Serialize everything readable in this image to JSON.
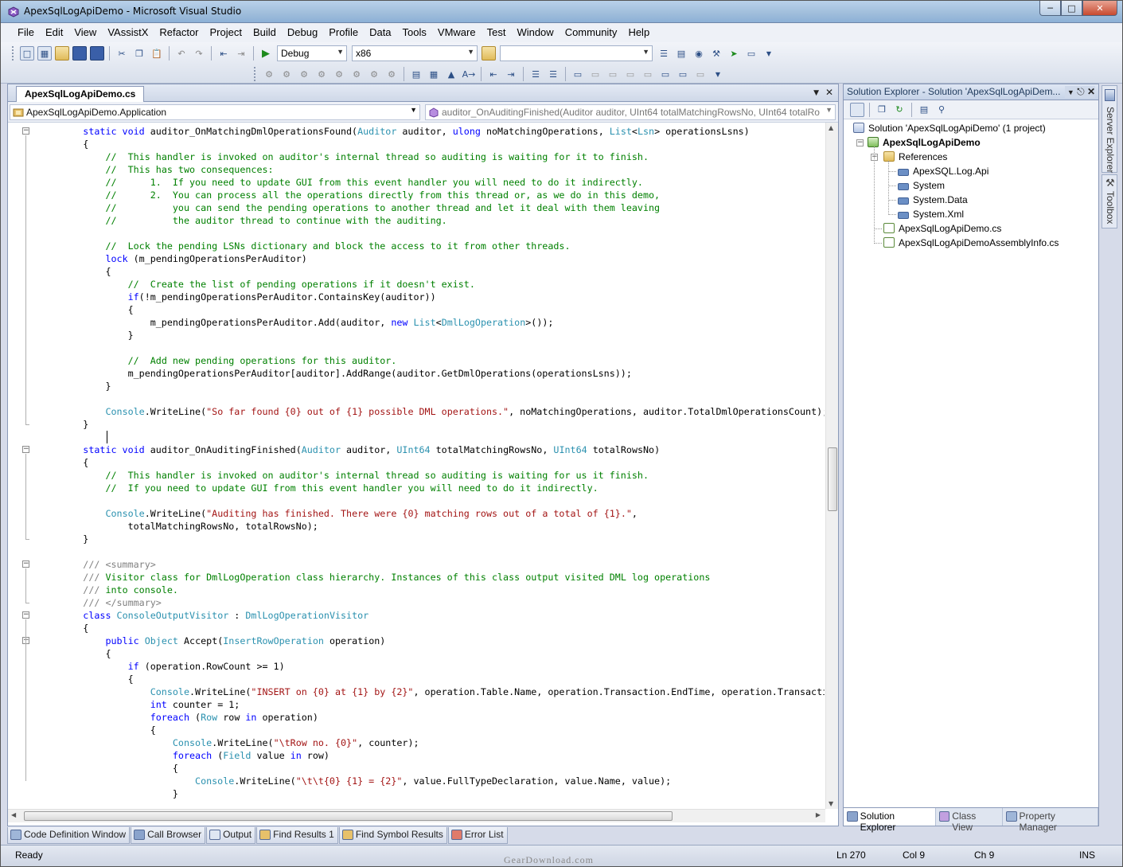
{
  "window": {
    "title": "ApexSqlLogApiDemo - Microsoft Visual Studio"
  },
  "menu": [
    "File",
    "Edit",
    "View",
    "VAssistX",
    "Refactor",
    "Project",
    "Build",
    "Debug",
    "Profile",
    "Data",
    "Tools",
    "VMware",
    "Test",
    "Window",
    "Community",
    "Help"
  ],
  "toolbar": {
    "config": "Debug",
    "platform": "x86",
    "search": ""
  },
  "editor": {
    "tab": "ApexSqlLogApiDemo.cs",
    "nav_type": "ApexSqlLogApiDemo.Application",
    "nav_member": "auditor_OnAuditingFinished(Auditor auditor, UInt64 totalMatchingRowsNo, UInt64 totalRo"
  },
  "code_lines": [
    [
      {
        "t": "        "
      },
      {
        "k": "kw",
        "t": "static void"
      },
      {
        "t": " auditor_OnMatchingDmlOperationsFound("
      },
      {
        "k": "ty",
        "t": "Auditor"
      },
      {
        "t": " auditor, "
      },
      {
        "k": "kw",
        "t": "ulong"
      },
      {
        "t": " noMatchingOperations, "
      },
      {
        "k": "ty",
        "t": "List"
      },
      {
        "t": "<"
      },
      {
        "k": "ty",
        "t": "Lsn"
      },
      {
        "t": "> operationsLsns)"
      }
    ],
    [
      {
        "t": "        {"
      }
    ],
    [
      {
        "t": "            "
      },
      {
        "k": "cm",
        "t": "//  This handler is invoked on auditor's internal thread so auditing is waiting for it to finish."
      }
    ],
    [
      {
        "t": "            "
      },
      {
        "k": "cm",
        "t": "//  This has two consequences:"
      }
    ],
    [
      {
        "t": "            "
      },
      {
        "k": "cm",
        "t": "//      1.  If you need to update GUI from this event handler you will need to do it indirectly."
      }
    ],
    [
      {
        "t": "            "
      },
      {
        "k": "cm",
        "t": "//      2.  You can process all the operations directly from this thread or, as we do in this demo,"
      }
    ],
    [
      {
        "t": "            "
      },
      {
        "k": "cm",
        "t": "//          you can send the pending operations to another thread and let it deal with them leaving"
      }
    ],
    [
      {
        "t": "            "
      },
      {
        "k": "cm",
        "t": "//          the auditor thread to continue with the auditing."
      }
    ],
    [
      {
        "t": ""
      }
    ],
    [
      {
        "t": "            "
      },
      {
        "k": "cm",
        "t": "//  Lock the pending LSNs dictionary and block the access to it from other threads."
      }
    ],
    [
      {
        "t": "            "
      },
      {
        "k": "kw",
        "t": "lock"
      },
      {
        "t": " (m_pendingOperationsPerAuditor)"
      }
    ],
    [
      {
        "t": "            {"
      }
    ],
    [
      {
        "t": "                "
      },
      {
        "k": "cm",
        "t": "//  Create the list of pending operations if it doesn't exist."
      }
    ],
    [
      {
        "t": "                "
      },
      {
        "k": "kw",
        "t": "if"
      },
      {
        "t": "(!m_pendingOperationsPerAuditor.ContainsKey(auditor))"
      }
    ],
    [
      {
        "t": "                {"
      }
    ],
    [
      {
        "t": "                    m_pendingOperationsPerAuditor.Add(auditor, "
      },
      {
        "k": "kw",
        "t": "new"
      },
      {
        "t": " "
      },
      {
        "k": "ty",
        "t": "List"
      },
      {
        "t": "<"
      },
      {
        "k": "ty",
        "t": "DmlLogOperation"
      },
      {
        "t": ">());"
      }
    ],
    [
      {
        "t": "                }"
      }
    ],
    [
      {
        "t": ""
      }
    ],
    [
      {
        "t": "                "
      },
      {
        "k": "cm",
        "t": "//  Add new pending operations for this auditor."
      }
    ],
    [
      {
        "t": "                m_pendingOperationsPerAuditor[auditor].AddRange(auditor.GetDmlOperations(operationsLsns));"
      }
    ],
    [
      {
        "t": "            }"
      }
    ],
    [
      {
        "t": ""
      }
    ],
    [
      {
        "t": "            "
      },
      {
        "k": "ty",
        "t": "Console"
      },
      {
        "t": ".WriteLine("
      },
      {
        "k": "st",
        "t": "\"So far found {0} out of {1} possible DML operations.\""
      },
      {
        "t": ", noMatchingOperations, auditor.TotalDmlOperationsCount);"
      }
    ],
    [
      {
        "t": "        }"
      }
    ],
    [
      {
        "t": ""
      }
    ],
    [
      {
        "t": "        "
      },
      {
        "k": "kw",
        "t": "static void"
      },
      {
        "t": " auditor_OnAuditingFinished("
      },
      {
        "k": "ty",
        "t": "Auditor"
      },
      {
        "t": " auditor, "
      },
      {
        "k": "ty",
        "t": "UInt64"
      },
      {
        "t": " totalMatchingRowsNo, "
      },
      {
        "k": "ty",
        "t": "UInt64"
      },
      {
        "t": " totalRowsNo)"
      }
    ],
    [
      {
        "t": "        {"
      }
    ],
    [
      {
        "t": "            "
      },
      {
        "k": "cm",
        "t": "//  This handler is invoked on auditor's internal thread so auditing is waiting for us it finish."
      }
    ],
    [
      {
        "t": "            "
      },
      {
        "k": "cm",
        "t": "//  If you need to update GUI from this event handler you will need to do it indirectly."
      }
    ],
    [
      {
        "t": ""
      }
    ],
    [
      {
        "t": "            "
      },
      {
        "k": "ty",
        "t": "Console"
      },
      {
        "t": ".WriteLine("
      },
      {
        "k": "st",
        "t": "\"Auditing has finished. There were {0} matching rows out of a total of {1}.\""
      },
      {
        "t": ","
      }
    ],
    [
      {
        "t": "                totalMatchingRowsNo, totalRowsNo);"
      }
    ],
    [
      {
        "t": "        }"
      }
    ],
    [
      {
        "t": ""
      }
    ],
    [
      {
        "t": "        "
      },
      {
        "k": "xd",
        "t": "/// <summary>"
      }
    ],
    [
      {
        "t": "        "
      },
      {
        "k": "xd",
        "t": "///"
      },
      {
        "k": "cm",
        "t": " Visitor class for DmlLogOperation class hierarchy. Instances of this class output visited DML log operations"
      }
    ],
    [
      {
        "t": "        "
      },
      {
        "k": "xd",
        "t": "///"
      },
      {
        "k": "cm",
        "t": " into console."
      }
    ],
    [
      {
        "t": "        "
      },
      {
        "k": "xd",
        "t": "/// </summary>"
      }
    ],
    [
      {
        "t": "        "
      },
      {
        "k": "kw",
        "t": "class"
      },
      {
        "t": " "
      },
      {
        "k": "ty",
        "t": "ConsoleOutputVisitor"
      },
      {
        "t": " : "
      },
      {
        "k": "ty",
        "t": "DmlLogOperationVisitor"
      }
    ],
    [
      {
        "t": "        {"
      }
    ],
    [
      {
        "t": "            "
      },
      {
        "k": "kw",
        "t": "public"
      },
      {
        "t": " "
      },
      {
        "k": "ty",
        "t": "Object"
      },
      {
        "t": " Accept("
      },
      {
        "k": "ty",
        "t": "InsertRowOperation"
      },
      {
        "t": " operation)"
      }
    ],
    [
      {
        "t": "            {"
      }
    ],
    [
      {
        "t": "                "
      },
      {
        "k": "kw",
        "t": "if"
      },
      {
        "t": " (operation.RowCount >= 1)"
      }
    ],
    [
      {
        "t": "                {"
      }
    ],
    [
      {
        "t": "                    "
      },
      {
        "k": "ty",
        "t": "Console"
      },
      {
        "t": ".WriteLine("
      },
      {
        "k": "st",
        "t": "\"INSERT on {0} at {1} by {2}\""
      },
      {
        "t": ", operation.Table.Name, operation.Transaction.EndTime, operation.Transaction.User"
      }
    ],
    [
      {
        "t": "                    "
      },
      {
        "k": "kw",
        "t": "int"
      },
      {
        "t": " counter = 1;"
      }
    ],
    [
      {
        "t": "                    "
      },
      {
        "k": "kw",
        "t": "foreach"
      },
      {
        "t": " ("
      },
      {
        "k": "ty",
        "t": "Row"
      },
      {
        "t": " row "
      },
      {
        "k": "kw",
        "t": "in"
      },
      {
        "t": " operation)"
      }
    ],
    [
      {
        "t": "                    {"
      }
    ],
    [
      {
        "t": "                        "
      },
      {
        "k": "ty",
        "t": "Console"
      },
      {
        "t": ".WriteLine("
      },
      {
        "k": "st",
        "t": "\"\\tRow no. {0}\""
      },
      {
        "t": ", counter);"
      }
    ],
    [
      {
        "t": "                        "
      },
      {
        "k": "kw",
        "t": "foreach"
      },
      {
        "t": " ("
      },
      {
        "k": "ty",
        "t": "Field"
      },
      {
        "t": " value "
      },
      {
        "k": "kw",
        "t": "in"
      },
      {
        "t": " row)"
      }
    ],
    [
      {
        "t": "                        {"
      }
    ],
    [
      {
        "t": "                            "
      },
      {
        "k": "ty",
        "t": "Console"
      },
      {
        "t": ".WriteLine("
      },
      {
        "k": "st",
        "t": "\"\\t\\t{0} {1} = {2}\""
      },
      {
        "t": ", value.FullTypeDeclaration, value.Name, value);"
      }
    ],
    [
      {
        "t": "                        }"
      }
    ]
  ],
  "colors": {
    "keyword": "#0000ff",
    "type": "#2b91af",
    "comment": "#008000",
    "string": "#a31515",
    "xmldoc": "#808080"
  },
  "solution_explorer": {
    "title": "Solution Explorer - Solution 'ApexSqlLogApiDem...",
    "nodes": [
      {
        "label": "Solution 'ApexSqlLogApiDemo' (1 project)",
        "icon": "solution-icon"
      },
      {
        "label": "ApexSqlLogApiDemo",
        "icon": "project-icon"
      },
      {
        "label": "References",
        "icon": "folder-icon"
      },
      {
        "label": "ApexSQL.Log.Api",
        "icon": "reference-icon"
      },
      {
        "label": "System",
        "icon": "reference-icon"
      },
      {
        "label": "System.Data",
        "icon": "reference-icon"
      },
      {
        "label": "System.Xml",
        "icon": "reference-icon"
      },
      {
        "label": "ApexSqlLogApiDemo.cs",
        "icon": "csharp-file-icon"
      },
      {
        "label": "ApexSqlLogApiDemoAssemblyInfo.cs",
        "icon": "csharp-file-icon"
      }
    ],
    "tabs": [
      "Solution Explorer",
      "Class View",
      "Property Manager"
    ]
  },
  "side_tabs": [
    "Server Explorer",
    "Toolbox"
  ],
  "bottom_tabs": [
    "Code Definition Window",
    "Call Browser",
    "Output",
    "Find Results 1",
    "Find Symbol Results",
    "Error List"
  ],
  "status": {
    "text": "Ready",
    "ln": "Ln 270",
    "col": "Col 9",
    "ch": "Ch 9",
    "mode": "INS"
  },
  "watermark": "GearDownload.com"
}
